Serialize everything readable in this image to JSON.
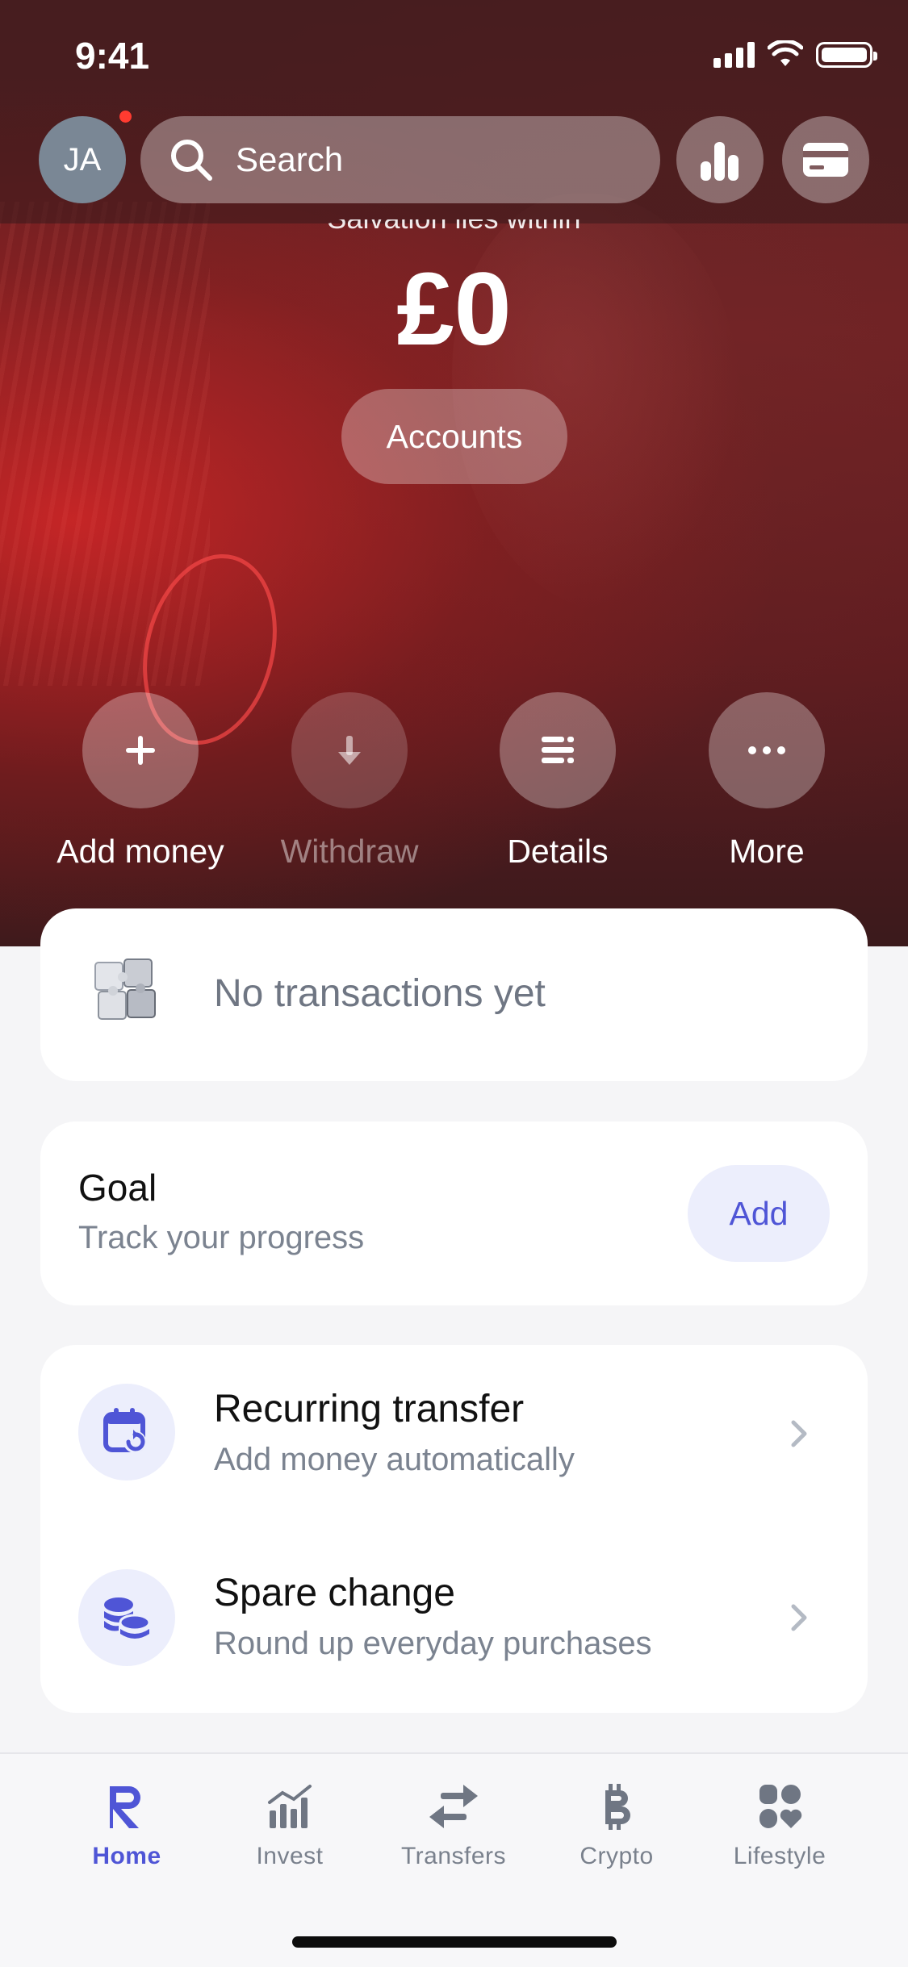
{
  "status_bar": {
    "time": "9:41"
  },
  "header": {
    "avatar_initials": "JA",
    "search_placeholder": "Search"
  },
  "balance": {
    "pocket_name": "Salvation lies within",
    "amount": "£0",
    "accounts_label": "Accounts"
  },
  "actions": [
    {
      "label": "Add money",
      "icon": "plus-icon",
      "enabled": true
    },
    {
      "label": "Withdraw",
      "icon": "arrow-down-icon",
      "enabled": false
    },
    {
      "label": "Details",
      "icon": "details-icon",
      "enabled": true
    },
    {
      "label": "More",
      "icon": "more-icon",
      "enabled": true
    }
  ],
  "transactions": {
    "empty_text": "No transactions yet"
  },
  "goal": {
    "title": "Goal",
    "subtitle": "Track your progress",
    "add_label": "Add"
  },
  "features": [
    {
      "title": "Recurring transfer",
      "subtitle": "Add money automatically",
      "icon": "calendar-repeat-icon"
    },
    {
      "title": "Spare change",
      "subtitle": "Round up everyday purchases",
      "icon": "coins-icon"
    }
  ],
  "tabs": [
    {
      "label": "Home",
      "icon": "revolut-r-icon",
      "active": true
    },
    {
      "label": "Invest",
      "icon": "chart-icon",
      "active": false
    },
    {
      "label": "Transfers",
      "icon": "transfer-arrows-icon",
      "active": false
    },
    {
      "label": "Crypto",
      "icon": "bitcoin-icon",
      "active": false
    },
    {
      "label": "Lifestyle",
      "icon": "lifestyle-icon",
      "active": false
    }
  ],
  "colors": {
    "accent": "#4f55d6",
    "accent_bg": "#eceefc",
    "hero": "#6d2124"
  }
}
